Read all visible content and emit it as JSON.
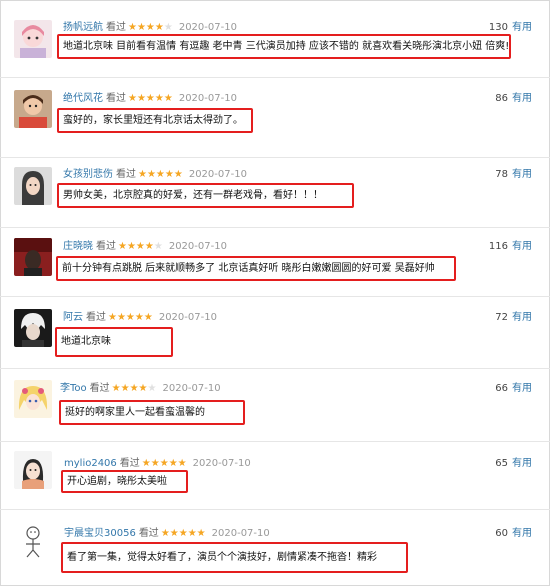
{
  "useful_label": "有用",
  "watched_label": "看过",
  "reviews": [
    {
      "user": "扬帆远航",
      "rating": 4,
      "date": "2020-07-10",
      "votes": "130",
      "text": "地道北京味 目前看有温情 有逗趣 老中青 三代演员加持 应该不错的 就喜欢看关晓彤演北京小妞 倍爽!",
      "avatar_icon": "cartoon-girl-avatar-icon"
    },
    {
      "user": "绝代风花",
      "rating": 5,
      "date": "2020-07-10",
      "votes": "86",
      "text": "蛮好的，家长里短还有北京话太得劲了。",
      "avatar_icon": "child-photo-avatar-icon"
    },
    {
      "user": "女孩别悲伤",
      "rating": 5,
      "date": "2020-07-10",
      "votes": "78",
      "text": "男帅女美，北京腔真的好爱，还有一群老戏骨，看好！！！",
      "avatar_icon": "woman-photo-avatar-icon"
    },
    {
      "user": "庄晓晓",
      "rating": 4,
      "date": "2020-07-10",
      "votes": "116",
      "text": "前十分钟有点跳脱 后来就顺畅多了 北京话真好听 晓彤白嫩嫩圆圆的好可爱 吴磊好帅",
      "avatar_icon": "dark-photo-avatar-icon"
    },
    {
      "user": "阿云",
      "rating": 5,
      "date": "2020-07-10",
      "votes": "72",
      "text": "地道北京味",
      "avatar_icon": "white-hair-avatar-icon"
    },
    {
      "user": "李Too",
      "rating": 4,
      "date": "2020-07-10",
      "votes": "66",
      "text": "挺好的啊家里人一起看蛮温馨的",
      "avatar_icon": "anime-girl-avatar-icon"
    },
    {
      "user": "mylio2406",
      "rating": 5,
      "date": "2020-07-10",
      "votes": "65",
      "text": "开心追剧，晓彤太美啦",
      "avatar_icon": "girl-photo-avatar-icon"
    },
    {
      "user": "宇晨宝贝30056",
      "rating": 5,
      "date": "2020-07-10",
      "votes": "60",
      "text": "看了第一集，觉得太好看了，演员个个演技好，剧情紧凑不拖沓！精彩",
      "avatar_icon": "sketch-avatar-icon"
    }
  ]
}
